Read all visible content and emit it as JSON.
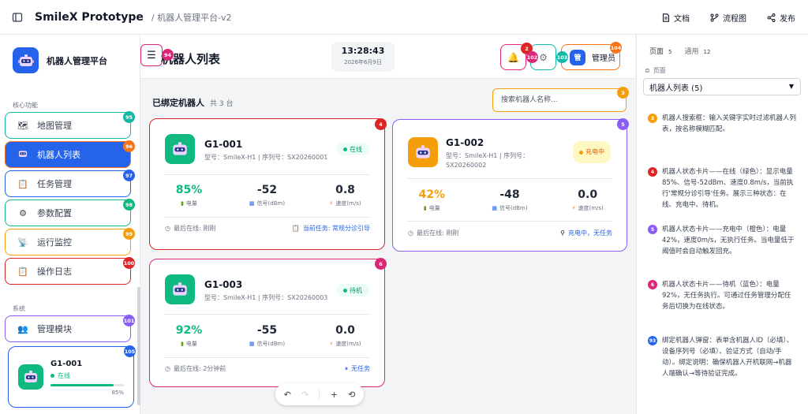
{
  "topbar": {
    "app_title": "SmileX Prototype",
    "breadcrumb": "/ 机器人管理平台-v2",
    "actions": [
      {
        "label": "文档",
        "icon": "document-icon"
      },
      {
        "label": "流程图",
        "icon": "flowchart-icon"
      },
      {
        "label": "发布",
        "icon": "share-icon"
      }
    ]
  },
  "sidebar": {
    "brand": "机器人管理平台",
    "section_core": "核心功能",
    "section_system": "系统",
    "items": [
      {
        "label": "地图管理",
        "badge": "95"
      },
      {
        "label": "机器人列表",
        "badge": "96"
      },
      {
        "label": "任务管理",
        "badge": "97"
      },
      {
        "label": "参数配置",
        "badge": "98"
      },
      {
        "label": "运行监控",
        "badge": "99"
      },
      {
        "label": "操作日志",
        "badge": "100"
      },
      {
        "label": "管理模块",
        "badge": "101"
      }
    ],
    "robot_card": {
      "name": "G1-001",
      "status": "在线",
      "battery": 85,
      "battery_text": "85%",
      "badge": "105"
    }
  },
  "header": {
    "menu_badge": "94",
    "title": "机器人列表",
    "time": "13:28:43",
    "date": "2026年6月9日",
    "bell_badge": "2",
    "settings_badges": [
      "102",
      "103"
    ],
    "user_label": "管理员",
    "user_avatar": "管",
    "user_badge": "104"
  },
  "list": {
    "title": "已绑定机器人",
    "count": "共 3 台",
    "search_placeholder": "搜索机器人名称...",
    "search_badge": "3"
  },
  "robots": [
    {
      "name": "G1-001",
      "meta": "型号：SmileX-H1 | 序列号：SX20260001",
      "status": "在线",
      "battery": "85%",
      "battery_label": "电量",
      "signal": "-52",
      "signal_label": "信号(dBm)",
      "speed": "0.8",
      "speed_label": "速度(m/s)",
      "last_online": "最后在线: 刚刚",
      "task": "当前任务: 常规分诊引导",
      "badge": "4"
    },
    {
      "name": "G1-002",
      "meta": "型号：SmileX-H1 | 序列号：SX20260002",
      "status": "充电中",
      "battery": "42%",
      "battery_label": "电量",
      "signal": "-48",
      "signal_label": "信号(dBm)",
      "speed": "0.0",
      "speed_label": "速度(m/s)",
      "last_online": "最后在线: 刚刚",
      "task": "充电中，无任务",
      "badge": "5"
    },
    {
      "name": "G1-003",
      "meta": "型号：SmileX-H1 | 序列号：SX20260003",
      "status": "待机",
      "battery": "92%",
      "battery_label": "电量",
      "signal": "-55",
      "signal_label": "信号(dBm)",
      "speed": "0.0",
      "speed_label": "速度(m/s)",
      "last_online": "最后在线: 2分钟前",
      "task": "无任务",
      "badge": "6"
    }
  ],
  "right_panel": {
    "tab_page": "页面",
    "tab_page_count": "5",
    "tab_common": "通用",
    "tab_common_count": "12",
    "label": "页面",
    "selected": "机器人列表 (5)",
    "notes": [
      {
        "num": "3",
        "text": "机器人搜索框：输入关键字实时过滤机器人列表，按名称模糊匹配。"
      },
      {
        "num": "4",
        "text": "机器人状态卡片——在线（绿色）：显示电量85%、信号-52dBm、速度0.8m/s，当前执行'常规分诊引导'任务。展示三种状态：在线、充电中、待机。"
      },
      {
        "num": "5",
        "text": "机器人状态卡片——充电中（橙色）：电量42%，速度0m/s，无执行任务。当电量低于阈值时会自动触发回充。"
      },
      {
        "num": "6",
        "text": "机器人状态卡片——待机（蓝色）：电量92%，无任务执行。可通过任务管理分配任务后切换为在线状态。"
      },
      {
        "num": "93",
        "text": "绑定机器人弹窗：表单含机器人ID（必填）、设备序列号（必填）、验证方式（自动/手动）。绑定说明：确保机器人开机联网→机器人端确认→等待验证完成。"
      }
    ]
  },
  "colors": {
    "primary": "#2563eb",
    "online": "#10b981",
    "charging": "#f59e0b",
    "standby": "#10b981",
    "pink": "#db2777",
    "teal": "#14b8a6",
    "purple": "#8b5cf6",
    "red": "#dc2626",
    "orange": "#f97316"
  }
}
